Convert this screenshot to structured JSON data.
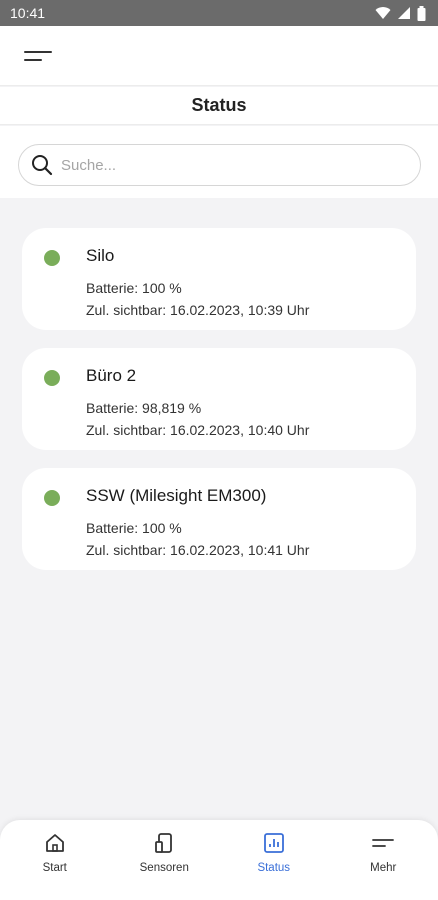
{
  "status_bar": {
    "time": "10:41"
  },
  "header": {
    "title": "Status"
  },
  "search": {
    "placeholder": "Suche..."
  },
  "sensors": [
    {
      "name": "Silo",
      "battery": "Batterie: 100 %",
      "last_seen": "Zul. sichtbar: 16.02.2023, 10:39 Uhr",
      "status_color": "#7aad5a"
    },
    {
      "name": "Büro 2",
      "battery": "Batterie: 98,819 %",
      "last_seen": "Zul. sichtbar: 16.02.2023, 10:40 Uhr",
      "status_color": "#7aad5a"
    },
    {
      "name": "SSW (Milesight EM300)",
      "battery": "Batterie: 100 %",
      "last_seen": "Zul. sichtbar: 16.02.2023, 10:41 Uhr",
      "status_color": "#7aad5a"
    }
  ],
  "bottom_nav": {
    "active": "Status",
    "accent_color": "#3a6fd8",
    "items": [
      {
        "label": "Start",
        "icon": "home-icon"
      },
      {
        "label": "Sensoren",
        "icon": "sensor-icon"
      },
      {
        "label": "Status",
        "icon": "bar-chart-icon"
      },
      {
        "label": "Mehr",
        "icon": "more-icon"
      }
    ]
  }
}
